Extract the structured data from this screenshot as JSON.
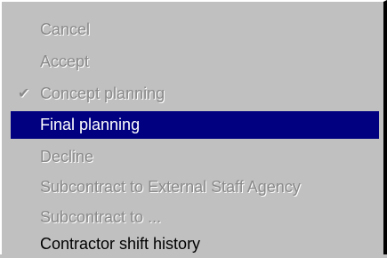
{
  "menu": {
    "items": [
      {
        "label": "Cancel",
        "state": "disabled"
      },
      {
        "label": "Accept",
        "state": "disabled"
      },
      {
        "label": "Concept planning",
        "state": "disabled",
        "checked": true,
        "check_glyph": "✔"
      },
      {
        "label": "Final planning",
        "state": "selected"
      },
      {
        "label": "Decline",
        "state": "disabled"
      },
      {
        "label": "Subcontract to External Staff Agency",
        "state": "disabled"
      },
      {
        "label": "Subcontract to ...",
        "state": "disabled"
      },
      {
        "label": "Contractor shift history",
        "state": "normal"
      }
    ]
  },
  "colors": {
    "menu_background": "#c0c0c0",
    "highlight_background": "#000080",
    "highlight_text": "#ffffff",
    "disabled_text": "#8a8a8a",
    "normal_text": "#000000"
  }
}
